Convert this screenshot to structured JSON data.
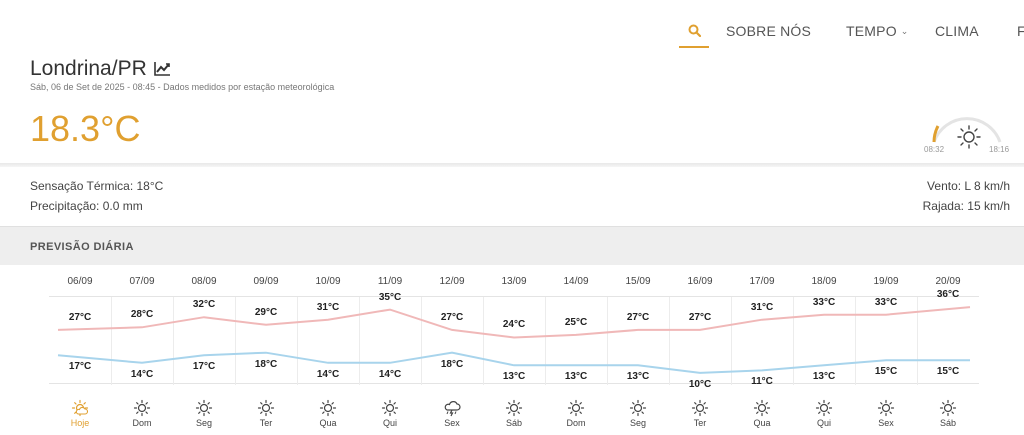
{
  "nav": {
    "items": [
      {
        "label": "SOBRE NÓS",
        "dropdown": false
      },
      {
        "label": "TEMPO",
        "dropdown": true
      },
      {
        "label": "CLIMA",
        "dropdown": false
      },
      {
        "label": "F",
        "dropdown": false
      }
    ]
  },
  "header": {
    "city": "Londrina/PR",
    "subinfo": "Sáb, 06 de Set de 2025 - 08:45 - Dados medidos por estação meteorológica",
    "temperature": "18.3°C",
    "sunrise": "08:32",
    "sunset": "18:16",
    "accent_color": "#e0a030"
  },
  "details": {
    "sensacao": "Sensação Térmica: 18°C",
    "precipitacao": "Precipitação: 0.0 mm",
    "vento": "Vento: L 8 km/h",
    "rajada": "Rajada: 15 km/h"
  },
  "section": {
    "title": "PREVISÃO DIÁRIA"
  },
  "chart_data": {
    "type": "line",
    "x": [
      "06/09",
      "07/09",
      "08/09",
      "09/09",
      "10/09",
      "11/09",
      "12/09",
      "13/09",
      "14/09",
      "15/09",
      "16/09",
      "17/09",
      "18/09",
      "19/09",
      "20/09"
    ],
    "days": [
      "Hoje",
      "Dom",
      "Seg",
      "Ter",
      "Qua",
      "Qui",
      "Sex",
      "Sáb",
      "Dom",
      "Seg",
      "Ter",
      "Qua",
      "Qui",
      "Sex",
      "Sáb"
    ],
    "icons": [
      "sun-cloud-icon",
      "sun-icon",
      "sun-icon",
      "sun-icon",
      "sun-icon",
      "sun-icon",
      "storm-icon",
      "sun-icon",
      "sun-icon",
      "sun-icon",
      "sun-icon",
      "sun-icon",
      "sun-icon",
      "sun-icon",
      "sun-icon"
    ],
    "series": [
      {
        "values": [
          27,
          28,
          32,
          29,
          31,
          35,
          27,
          24,
          25,
          27,
          27,
          31,
          33,
          33,
          36
        ],
        "color": "#f0b8b8"
      },
      {
        "values": [
          17,
          14,
          17,
          18,
          14,
          14,
          18,
          13,
          13,
          13,
          10,
          11,
          13,
          15,
          15
        ],
        "color": "#a8d4ec"
      }
    ],
    "unit": "°C"
  }
}
